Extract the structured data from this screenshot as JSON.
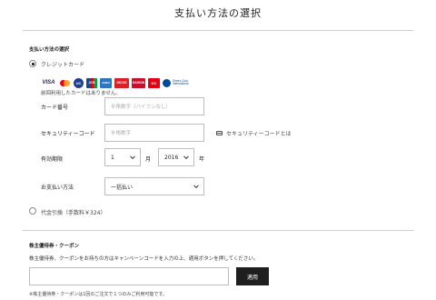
{
  "page": {
    "title": "支払い方法の選択"
  },
  "payment": {
    "heading": "支払い方法の選択",
    "options": [
      {
        "label": "クレジットカード",
        "selected": true
      },
      {
        "label": "代金引換（手数料￥324）",
        "selected": false
      }
    ],
    "card_brands": [
      "VISA",
      "Mastercard",
      "UC",
      "JCB",
      "AMEX",
      "NICOS",
      "SAISON",
      "DC",
      "Diners Club International"
    ],
    "card_brand_labels": {
      "visa": "VISA",
      "uc": "UC",
      "jcb": "JCB",
      "amex": "AMEX",
      "nicos": "NICOS",
      "saison": "SAISON",
      "dc": "DC",
      "diners": "Diners Club International"
    },
    "no_saved_cards_note": "前回利用したカードはありません。",
    "card_number": {
      "label": "カード番号",
      "placeholder": "半角数字（ハイフンなし）"
    },
    "security_code": {
      "label": "セキュリティーコード",
      "placeholder": "半角数字",
      "help_link": "セキュリティーコードとは"
    },
    "expiry": {
      "label": "有効期限",
      "month": "1",
      "month_unit": "月",
      "year": "2016",
      "year_unit": "年"
    },
    "installments": {
      "label": "お支払い方法",
      "value": "一括払い"
    }
  },
  "coupon": {
    "heading": "株主優待券・クーポン",
    "instruction": "株主優待券、クーポンをお持ちの方はキャンペーンコードを入力の上、適用ボタンを押してください。",
    "apply_label": "適用",
    "footnote": "※株主優待券・クーポンは1回のご注文で１つのみご利用可能です。"
  },
  "colors": {
    "button_bg": "#1f1f1f",
    "border": "#bdbdbd",
    "rule": "#cfcfcf"
  }
}
